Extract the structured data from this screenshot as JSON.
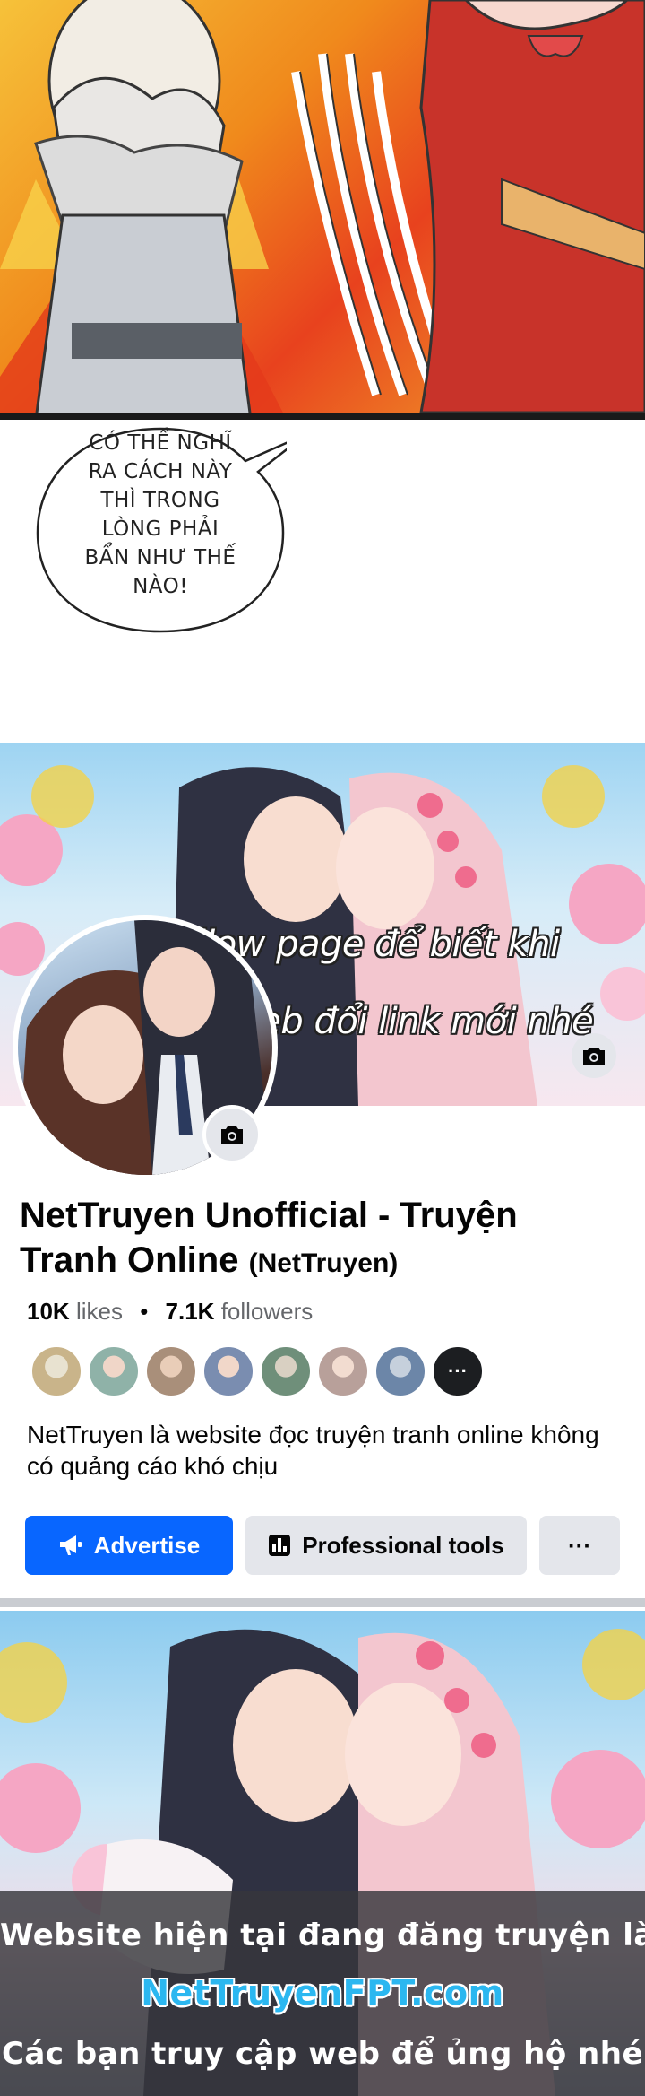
{
  "manga": {
    "speech_bubble": [
      "CÓ THỂ NGHĨ",
      "RA CÁCH NÀY",
      "THÌ TRONG",
      "LÒNG PHẢI",
      "BẨN NHƯ THẾ",
      "NÀO!"
    ]
  },
  "facebook_page": {
    "cover_overlay": [
      "Follow page để biết khi",
      "nào web đổi link mới nhé"
    ],
    "name": "NetTruyen Unofficial - Truyện Tranh Online",
    "handle": "(NetTruyen)",
    "likes_count": "10K",
    "likes_label": "likes",
    "followers_count": "7.1K",
    "followers_label": "followers",
    "separator": "•",
    "description": "NetTruyen là website đọc truyện tranh online không có quảng cáo khó chịu",
    "buttons": {
      "advertise": "Advertise",
      "professional_tools": "Professional tools",
      "more": "···"
    },
    "friend_avatar_colors": [
      "#c9b48a",
      "#8fb2a8",
      "#a98f7a",
      "#7a8db0",
      "#6f8f7a",
      "#b8a09a",
      "#6c86a8"
    ],
    "more_friends": "···"
  },
  "banner": {
    "line1": "Website hiện tại đang đăng truyện là",
    "line2": "NetTruyenFPT.com",
    "line3": "Các bạn truy cập web để ủng hộ nhé"
  },
  "colors": {
    "accent_blue": "#0866ff",
    "banner_link": "#2bb7f0",
    "button_gray": "#e4e6eb"
  }
}
